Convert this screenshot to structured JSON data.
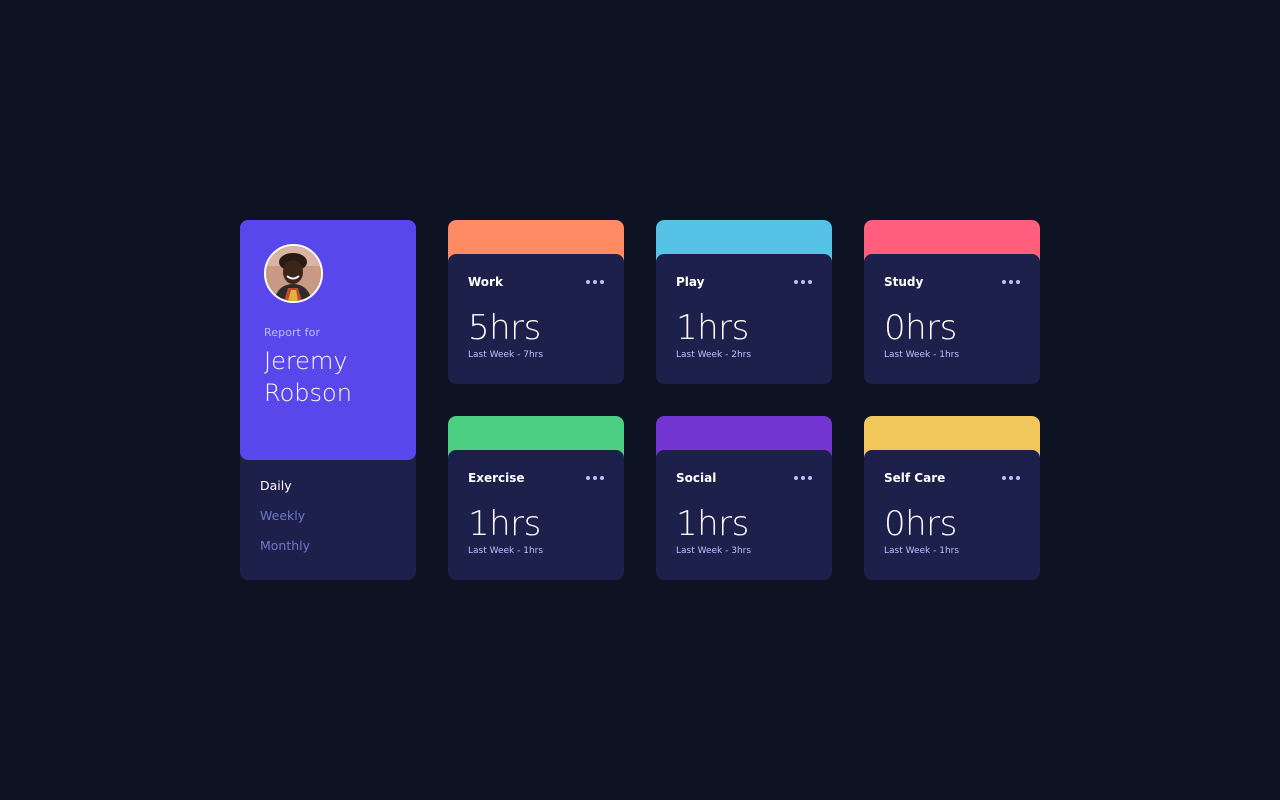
{
  "profile": {
    "report_label": "Report for",
    "name": "Jeremy Robson",
    "avatar_icon": "user-avatar"
  },
  "timeframes": [
    {
      "label": "Daily",
      "active": true
    },
    {
      "label": "Weekly",
      "active": false
    },
    {
      "label": "Monthly",
      "active": false
    }
  ],
  "activities": [
    {
      "title": "Work",
      "hours": "5hrs",
      "previous": "Last Week - 7hrs",
      "color": "#ff8b64"
    },
    {
      "title": "Play",
      "hours": "1hrs",
      "previous": "Last Week - 2hrs",
      "color": "#55c2e6"
    },
    {
      "title": "Study",
      "hours": "0hrs",
      "previous": "Last Week - 1hrs",
      "color": "#ff5e7d"
    },
    {
      "title": "Exercise",
      "hours": "1hrs",
      "previous": "Last Week - 1hrs",
      "color": "#4bcf82"
    },
    {
      "title": "Social",
      "hours": "1hrs",
      "previous": "Last Week - 3hrs",
      "color": "#7335d2"
    },
    {
      "title": "Self Care",
      "hours": "0hrs",
      "previous": "Last Week - 1hrs",
      "color": "#f1c75b"
    }
  ],
  "card_menu_icon": "ellipsis-icon",
  "colors": {
    "background": "#0e1323",
    "card": "#1c204b",
    "accent": "#5847eb",
    "muted": "#7078c9",
    "pale": "#bbc0ff"
  }
}
